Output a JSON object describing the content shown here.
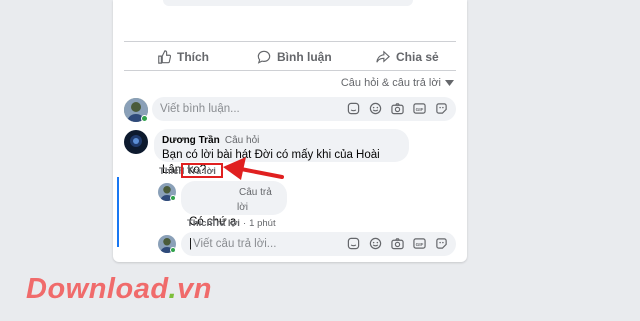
{
  "actions": {
    "like_label": "Thích",
    "comment_label": "Bình luận",
    "share_label": "Chia sẻ"
  },
  "sort": {
    "label": "Câu hỏi & câu trả lời"
  },
  "composer": {
    "placeholder": "Viết bình luận..."
  },
  "question": {
    "author": "Dương Trần",
    "tag": "Câu hỏi",
    "text": "Bạn có lời bài hát Đời có mấy khi của Hoài Lâm ko?",
    "like_label": "Thích",
    "reply_label": "Trả lời"
  },
  "answer": {
    "tag": "Câu trả lời",
    "text": "Có chứ ạ",
    "like_label": "Thích",
    "reply_label": "Trả lời",
    "time": "1 phút"
  },
  "reply_composer": {
    "placeholder": "Viết câu trả lời..."
  },
  "watermark": {
    "text_main": "Download",
    "text_tld": "vn"
  },
  "colors": {
    "accent": "#1877f2",
    "highlight": "#e02020",
    "online": "#31a24c"
  }
}
